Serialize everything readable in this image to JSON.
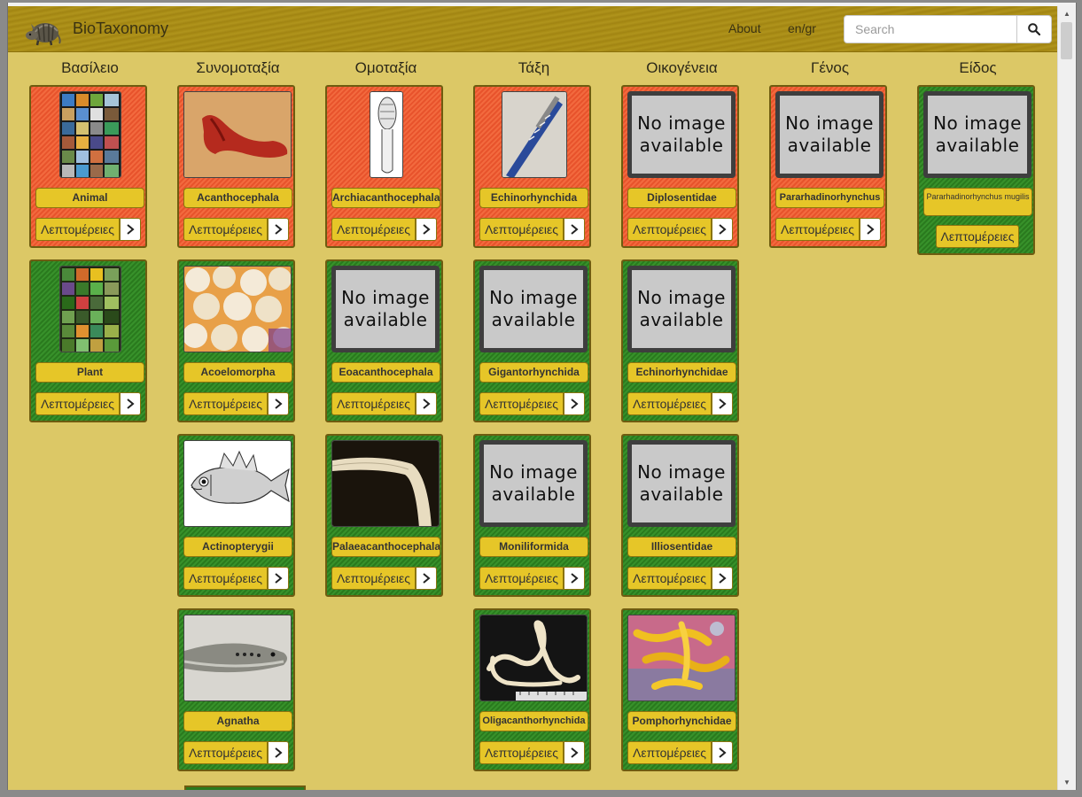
{
  "app": {
    "brand": "BioTaxonomy"
  },
  "nav": {
    "about": "About",
    "lang": "en/gr",
    "search_placeholder": "Search"
  },
  "columns": [
    "Βασίλειο",
    "Συνομοταξία",
    "Ομοταξία",
    "Τάξη",
    "Οικογένεια",
    "Γένος",
    "Είδος"
  ],
  "details_label": "Λεπτομέρειες",
  "no_image": [
    "No image",
    "available"
  ],
  "cards": {
    "kingdom_animal": "Animal",
    "kingdom_plant": "Plant",
    "phylum_1": "Acanthocephala",
    "phylum_2": "Acoelomorpha",
    "phylum_3": "Actinopterygii",
    "phylum_4": "Agnatha",
    "class_1": "Archiacanthocephala",
    "class_2": "Eoacanthocephala",
    "class_3": "Palaeacanthocephala",
    "order_1": "Echinorhynchida",
    "order_2": "Gigantorhynchida",
    "order_3": "Moniliformida",
    "order_4": "Oligacanthorhynchida",
    "family_1": "Diplosentidae",
    "family_2": "Echinorhynchidae",
    "family_3": "Illiosentidae",
    "family_4": "Pomphorhynchidae",
    "genus_1": "Pararhadinorhynchus",
    "species_1": "Pararhadinorhynchus mugilis"
  },
  "colors": {
    "selected": "#f26a3e",
    "unselected": "#37912a",
    "background": "#dcc866",
    "navbar": "#a8891a"
  }
}
